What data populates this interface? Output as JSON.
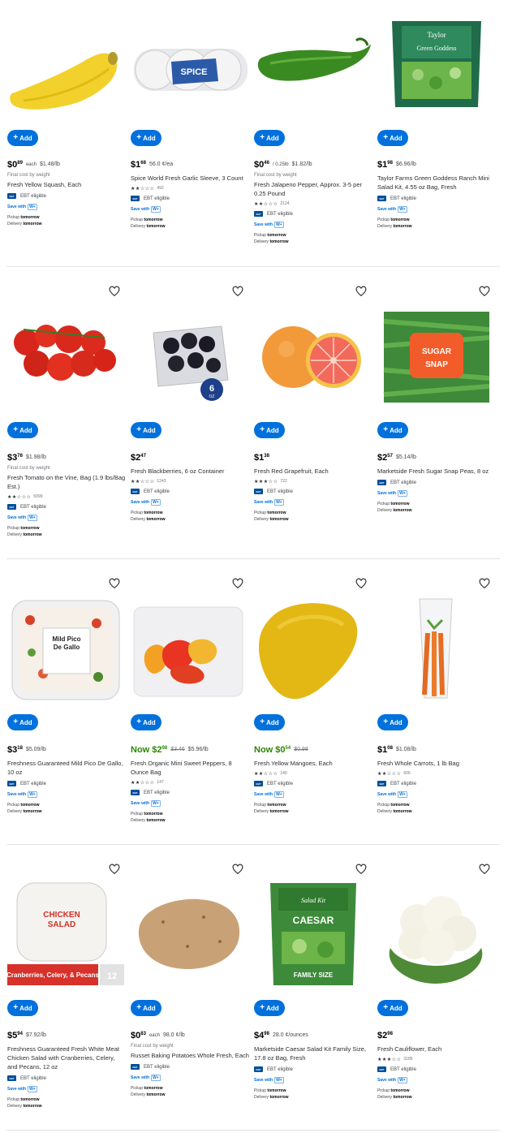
{
  "common": {
    "add_label": "Add",
    "ebt_badge": "EBT",
    "ebt_label": "EBT eligible",
    "save_with": "Save with",
    "wplus": "W+",
    "pickup_label": "Pickup",
    "delivery_label": "Delivery",
    "tomorrow": "tomorrow",
    "final_cost": "Final cost by weight"
  },
  "products": [
    {
      "dollars": "$0",
      "cents": "89",
      "each": "each",
      "unit_price": "$1.48/lb",
      "final": "Final cost by weight",
      "title": "Fresh Yellow Squash, Each",
      "stars": "",
      "reviews": "",
      "ebt": true,
      "now": false,
      "was": "",
      "icon": "yellow-squash-image"
    },
    {
      "dollars": "$1",
      "cents": "68",
      "each": "",
      "unit_price": "56.0 ¢/ea",
      "final": "",
      "title": "Spice World Fresh Garlic Sleeve, 3 Count",
      "stars": "★★☆☆☆",
      "reviews": "492",
      "ebt": true,
      "now": false,
      "was": "",
      "icon": "garlic-sleeve-image"
    },
    {
      "dollars": "$0",
      "cents": "46",
      "each": "/ 0.25lb",
      "unit_price": "$1.82/lb",
      "final": "Final cost by weight",
      "title": "Fresh Jalapeno Pepper, Approx. 3-5 per 0.25 Pound",
      "stars": "★★☆☆☆",
      "reviews": "2124",
      "ebt": true,
      "now": false,
      "was": "",
      "icon": "jalapeno-image"
    },
    {
      "dollars": "$1",
      "cents": "98",
      "each": "",
      "unit_price": "$6.96/lb",
      "final": "",
      "title": "Taylor Farms Green Goddess Ranch Mini Salad Kit, 4.55 oz Bag, Fresh",
      "stars": "",
      "reviews": "",
      "ebt": true,
      "now": false,
      "was": "",
      "icon": "salad-kit-image"
    },
    {
      "dollars": "$3",
      "cents": "76",
      "each": "",
      "unit_price": "$1.98/lb",
      "final": "Final cost by weight",
      "title": "Fresh Tomato on the Vine, Bag (1.9 lbs/Bag Est.)",
      "stars": "★★☆☆☆",
      "reviews": "5099",
      "ebt": true,
      "now": false,
      "was": "",
      "icon": "tomato-vine-image"
    },
    {
      "dollars": "$2",
      "cents": "47",
      "each": "",
      "unit_price": "",
      "final": "",
      "title": "Fresh Blackberries, 6 oz Container",
      "stars": "★★☆☆☆",
      "reviews": "1243",
      "ebt": true,
      "now": false,
      "was": "",
      "icon": "blackberries-image",
      "badge_text": "6",
      "badge_sub": "OZ"
    },
    {
      "dollars": "$1",
      "cents": "38",
      "each": "",
      "unit_price": "",
      "final": "",
      "title": "Fresh Red Grapefruit, Each",
      "stars": "★★★☆☆",
      "reviews": "722",
      "ebt": true,
      "now": false,
      "was": "",
      "icon": "grapefruit-image"
    },
    {
      "dollars": "$2",
      "cents": "57",
      "each": "",
      "unit_price": "$5.14/lb",
      "final": "",
      "title": "Marketside Fresh Sugar Snap Peas, 8 oz",
      "stars": "",
      "reviews": "",
      "ebt": true,
      "now": false,
      "was": "",
      "icon": "snap-peas-image",
      "pack_text": "SUGAR SNAP PEAS"
    },
    {
      "dollars": "$3",
      "cents": "18",
      "each": "",
      "unit_price": "$5.09/lb",
      "final": "",
      "title": "Freshness Guaranteed Mild Pico De Gallo, 10 oz",
      "stars": "",
      "reviews": "",
      "ebt": true,
      "now": false,
      "was": "",
      "icon": "pico-de-gallo-image",
      "pack_text": "Mild Pico De Gallo"
    },
    {
      "dollars": "Now $2",
      "cents": "98",
      "each": "",
      "unit_price": "$5.96/lb",
      "final": "",
      "title": "Fresh Organic Mini Sweet Peppers, 8 Ounce Bag",
      "stars": "★★☆☆☆",
      "reviews": "147",
      "ebt": true,
      "now": true,
      "was": "$3.46",
      "icon": "mini-peppers-image"
    },
    {
      "dollars": "Now $0",
      "cents": "54",
      "each": "",
      "unit_price": "",
      "final": "",
      "title": "Fresh Yellow Mangoes, Each",
      "stars": "★★☆☆☆",
      "reviews": "140",
      "ebt": true,
      "now": true,
      "was": "$0.98",
      "icon": "mango-image"
    },
    {
      "dollars": "$1",
      "cents": "08",
      "each": "",
      "unit_price": "$1.08/lb",
      "final": "",
      "title": "Fresh Whole Carrots, 1 lb Bag",
      "stars": "★★☆☆☆",
      "reviews": "606",
      "ebt": true,
      "now": false,
      "was": "",
      "icon": "carrots-image"
    },
    {
      "dollars": "$5",
      "cents": "94",
      "each": "",
      "unit_price": "$7.92/lb",
      "final": "",
      "title": "Freshness Guaranteed Fresh White Meat Chicken Salad with Cranberries, Celery, and Pecans, 12 oz",
      "stars": "",
      "reviews": "",
      "ebt": true,
      "now": false,
      "was": "",
      "icon": "chicken-salad-image",
      "pack_text": "CHICKEN SALAD",
      "banner_text": "Cranberries, Celery, & Pecans",
      "size_text": "12"
    },
    {
      "dollars": "$0",
      "cents": "83",
      "each": "each",
      "unit_price": "98.0 ¢/lb",
      "final": "Final cost by weight",
      "title": "Russet Baking Potatoes Whole Fresh, Each",
      "stars": "",
      "reviews": "",
      "ebt": true,
      "now": false,
      "was": "",
      "icon": "potato-image"
    },
    {
      "dollars": "$4",
      "cents": "98",
      "each": "",
      "unit_price": "28.0 ¢/ounces",
      "final": "",
      "title": "Marketside Caesar Salad Kit Family Size, 17.8 oz Bag, Fresh",
      "stars": "",
      "reviews": "",
      "ebt": true,
      "now": false,
      "was": "",
      "icon": "caesar-kit-image",
      "pack_text": "CAESAR",
      "pack_sub": "FAMILY SIZE"
    },
    {
      "dollars": "$2",
      "cents": "98",
      "each": "",
      "unit_price": "",
      "final": "",
      "title": "Fresh Cauliflower, Each",
      "stars": "★★★☆☆",
      "reviews": "3185",
      "ebt": true,
      "now": false,
      "was": "",
      "icon": "cauliflower-image"
    }
  ]
}
